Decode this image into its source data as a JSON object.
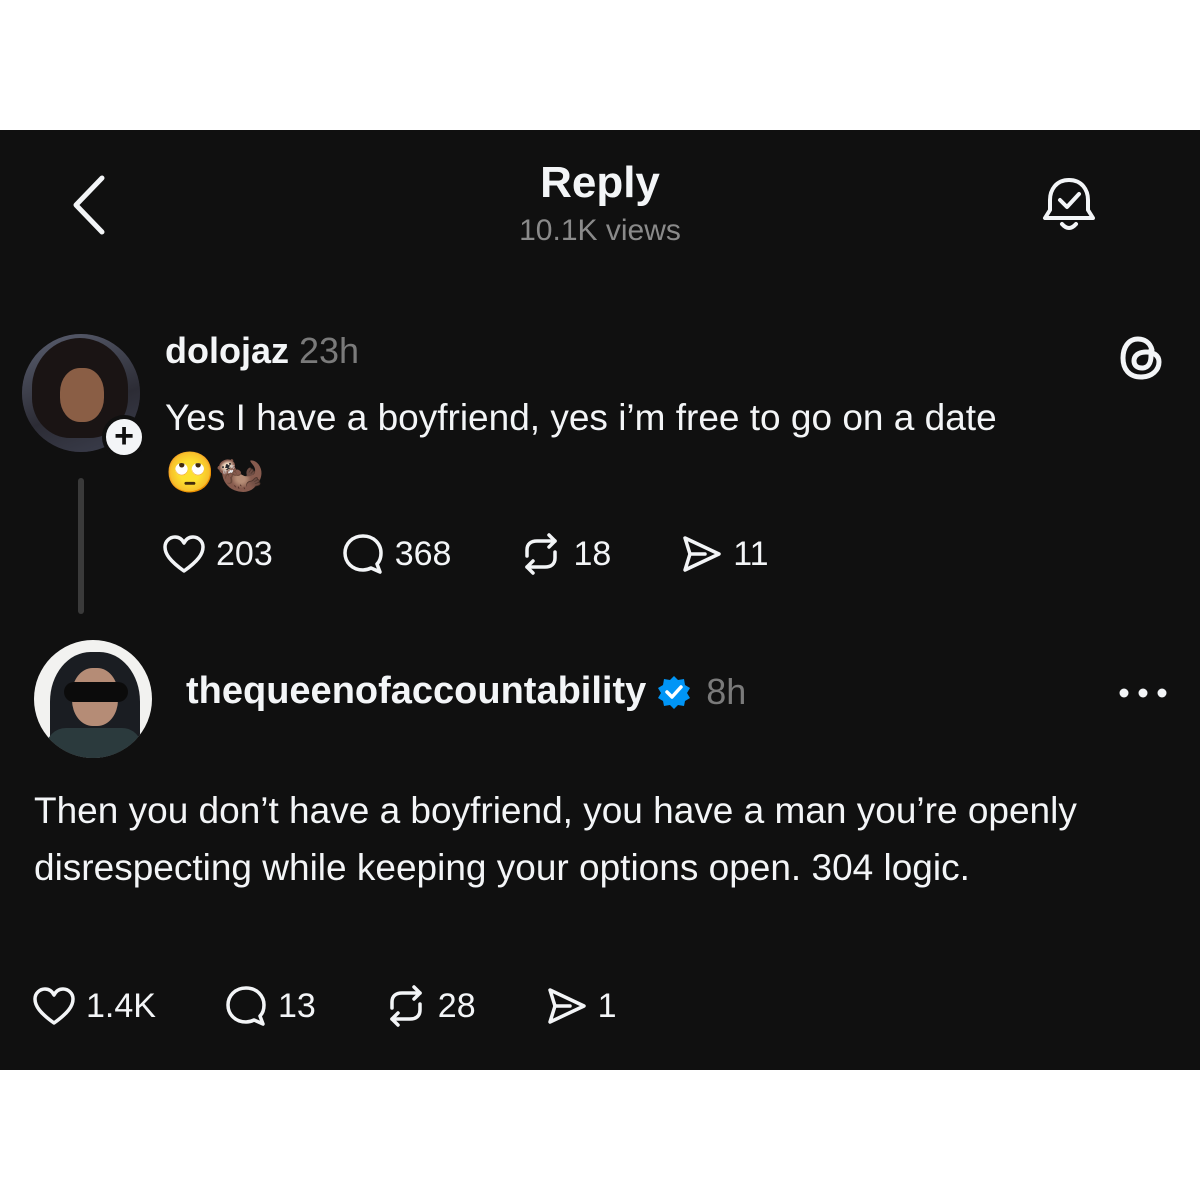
{
  "header": {
    "title": "Reply",
    "views": "10.1K views"
  },
  "post1": {
    "username": "dolojaz",
    "time": "23h",
    "text": "Yes I have a boyfriend, yes i’m free to go on a date",
    "emojis": "🙄🦦",
    "likes": "203",
    "replies": "368",
    "reposts": "18",
    "shares": "11"
  },
  "post2": {
    "username": "thequeenofaccountability",
    "time": "8h",
    "text": "Then you don’t have a boyfriend, you have a man you’re openly disrespecting while keeping your options open. 304 logic.",
    "likes": "1.4K",
    "replies": "13",
    "reposts": "28",
    "shares": "1"
  },
  "colors": {
    "background": "#101010",
    "text": "#f3f5f7",
    "muted": "#7a7a7a",
    "verified": "#0095f6"
  },
  "icons": [
    "back-chevron-icon",
    "bell-check-icon",
    "threads-logo-icon",
    "heart-icon",
    "comment-icon",
    "repost-icon",
    "share-icon",
    "verified-badge-icon",
    "more-icon",
    "plus-icon"
  ]
}
